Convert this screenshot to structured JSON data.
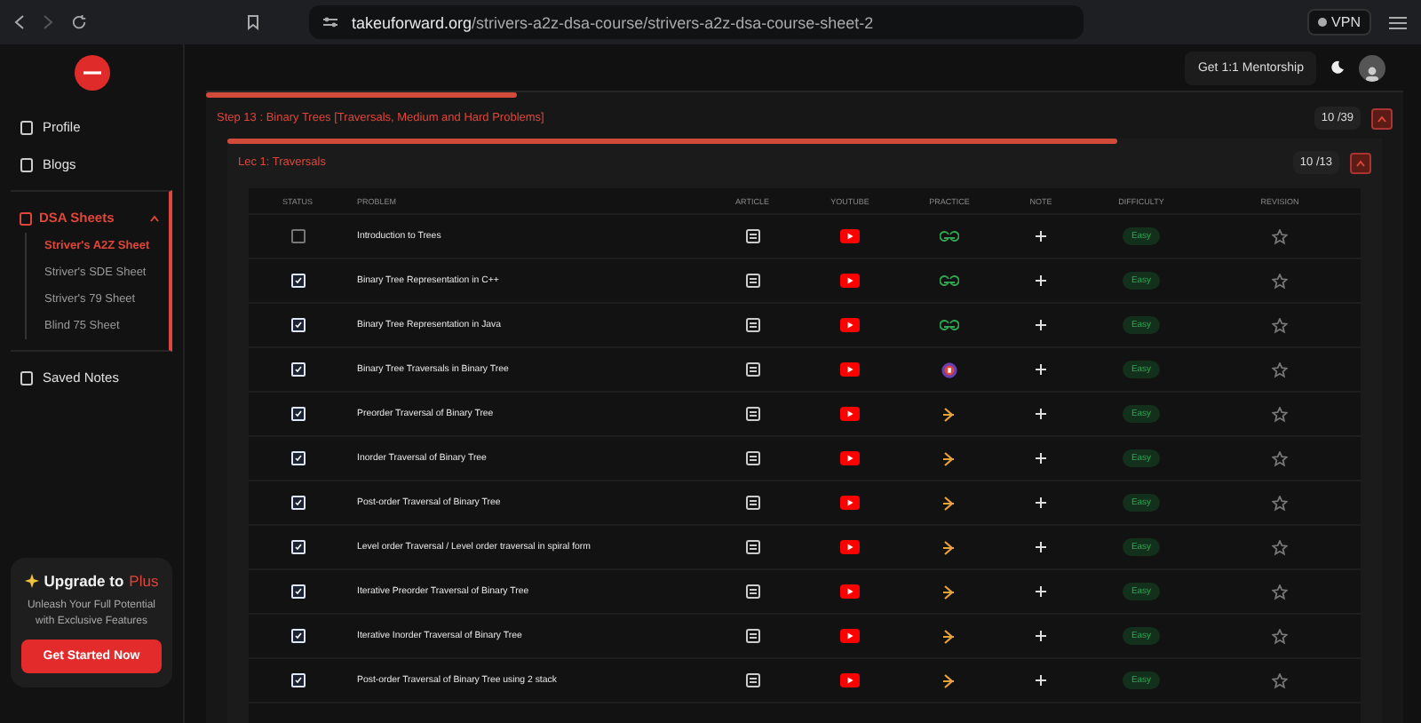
{
  "browser": {
    "url_host": "takeuforward.org",
    "url_path": "/strivers-a2z-dsa-course/strivers-a2z-dsa-course-sheet-2",
    "vpn": "VPN"
  },
  "sidebar": {
    "items": [
      {
        "label": "Profile",
        "kind": "link"
      },
      {
        "label": "Blogs",
        "kind": "link"
      },
      {
        "label": "DSA Sheets",
        "kind": "group",
        "expanded": true,
        "children": [
          {
            "label": "Striver's A2Z Sheet",
            "selected": true
          },
          {
            "label": "Striver's SDE Sheet",
            "selected": false
          },
          {
            "label": "Striver's 79 Sheet",
            "selected": false
          },
          {
            "label": "Blind 75 Sheet",
            "selected": false
          }
        ]
      },
      {
        "label": "Saved Notes",
        "kind": "link"
      }
    ],
    "upgrade": {
      "title": "Upgrade to",
      "plan": "Plus",
      "text": "Unleash Your Full Potential with Exclusive Features",
      "button": "Get Started Now"
    }
  },
  "header": {
    "mentorship": "Get 1:1 Mentorship"
  },
  "step": {
    "title": "Step 13 : Binary Trees [Traversals, Medium and Hard Problems]",
    "count": "10 /39",
    "level": 0.26,
    "expanded": true
  },
  "lecture": {
    "title": "Lec 1: Traversals",
    "count": "10 /13",
    "level": 0.77,
    "expanded": true
  },
  "table": {
    "columns": [
      "STATUS",
      "PROBLEM",
      "ARTICLE",
      "YOUTUBE",
      "PRACTICE",
      "NOTE",
      "DIFFICULTY",
      "REVISION"
    ],
    "rows": [
      {
        "checked": false,
        "problem": "Introduction to Trees",
        "practice": {
          "kind": "double-g"
        },
        "difficulty": "Easy",
        "starred": false
      },
      {
        "checked": true,
        "problem": "Binary Tree Representation in C++",
        "practice": {
          "kind": "double-g"
        },
        "difficulty": "Easy",
        "starred": false
      },
      {
        "checked": true,
        "problem": "Binary Tree Representation in Java",
        "practice": {
          "kind": "double-g"
        },
        "difficulty": "Easy",
        "starred": false
      },
      {
        "checked": true,
        "problem": "Binary Tree Traversals in Binary Tree",
        "practice": {
          "kind": "badge"
        },
        "difficulty": "Easy",
        "starred": false
      },
      {
        "checked": true,
        "problem": "Preorder Traversal of Binary Tree",
        "practice": {
          "kind": "arrow"
        },
        "difficulty": "Easy",
        "starred": false
      },
      {
        "checked": true,
        "problem": "Inorder Traversal of Binary Tree",
        "practice": {
          "kind": "arrow"
        },
        "difficulty": "Easy",
        "starred": false
      },
      {
        "checked": true,
        "problem": "Post-order Traversal of Binary Tree",
        "practice": {
          "kind": "arrow"
        },
        "difficulty": "Easy",
        "starred": false
      },
      {
        "checked": true,
        "problem": "Level order Traversal / Level order traversal in spiral form",
        "practice": {
          "kind": "arrow"
        },
        "difficulty": "Easy",
        "starred": false
      },
      {
        "checked": true,
        "problem": "Iterative Preorder Traversal of Binary Tree",
        "practice": {
          "kind": "arrow"
        },
        "difficulty": "Easy",
        "starred": false
      },
      {
        "checked": true,
        "problem": "Iterative Inorder Traversal of Binary Tree",
        "practice": {
          "kind": "arrow"
        },
        "difficulty": "Easy",
        "starred": false
      },
      {
        "checked": true,
        "problem": "Post-order Traversal of Binary Tree using 2 stack",
        "practice": {
          "kind": "arrow"
        },
        "difficulty": "Easy",
        "starred": false
      }
    ]
  }
}
